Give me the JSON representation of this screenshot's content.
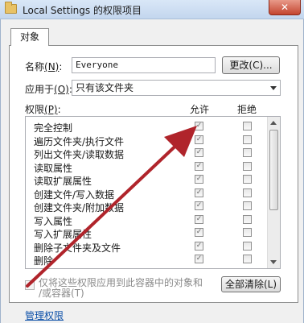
{
  "window": {
    "title": "Local Settings 的权限项目",
    "close_label": "✕"
  },
  "tabs": [
    {
      "label": "对象"
    }
  ],
  "name_row": {
    "label": "名称",
    "hotkey": "(N)",
    "hotkey_sep": ":",
    "value": "Everyone",
    "change_button": "更改(C)..."
  },
  "apply_row": {
    "label": "应用于",
    "hotkey": "(O)",
    "hotkey_sep": ":",
    "selected": "只有该文件夹"
  },
  "permissions": {
    "label": "权限",
    "hotkey": "(P)",
    "hotkey_sep": ":",
    "allow_header": "允许",
    "deny_header": "拒绝",
    "rows": [
      {
        "name": "完全控制",
        "allow": true,
        "deny": false
      },
      {
        "name": "遍历文件夹/执行文件",
        "allow": true,
        "deny": false
      },
      {
        "name": "列出文件夹/读取数据",
        "allow": true,
        "deny": false
      },
      {
        "name": "读取属性",
        "allow": true,
        "deny": false
      },
      {
        "name": "读取扩展属性",
        "allow": true,
        "deny": false
      },
      {
        "name": "创建文件/写入数据",
        "allow": true,
        "deny": false
      },
      {
        "name": "创建文件夹/附加数据",
        "allow": true,
        "deny": false
      },
      {
        "name": "写入属性",
        "allow": true,
        "deny": false
      },
      {
        "name": "写入扩展属性",
        "allow": true,
        "deny": false
      },
      {
        "name": "删除子文件夹及文件",
        "allow": true,
        "deny": false
      },
      {
        "name": "删除",
        "allow": true,
        "deny": false
      }
    ]
  },
  "inherit_option": {
    "line1": "仅将这些权限应用到此容器中的对象和",
    "line2": "/或容器(T)",
    "checked": false
  },
  "clear_all_button": "全部清除(L)",
  "manage_link": "管理权限",
  "colors": {
    "annotation_arrow": "#b0242b",
    "link": "#0b4fa8"
  }
}
